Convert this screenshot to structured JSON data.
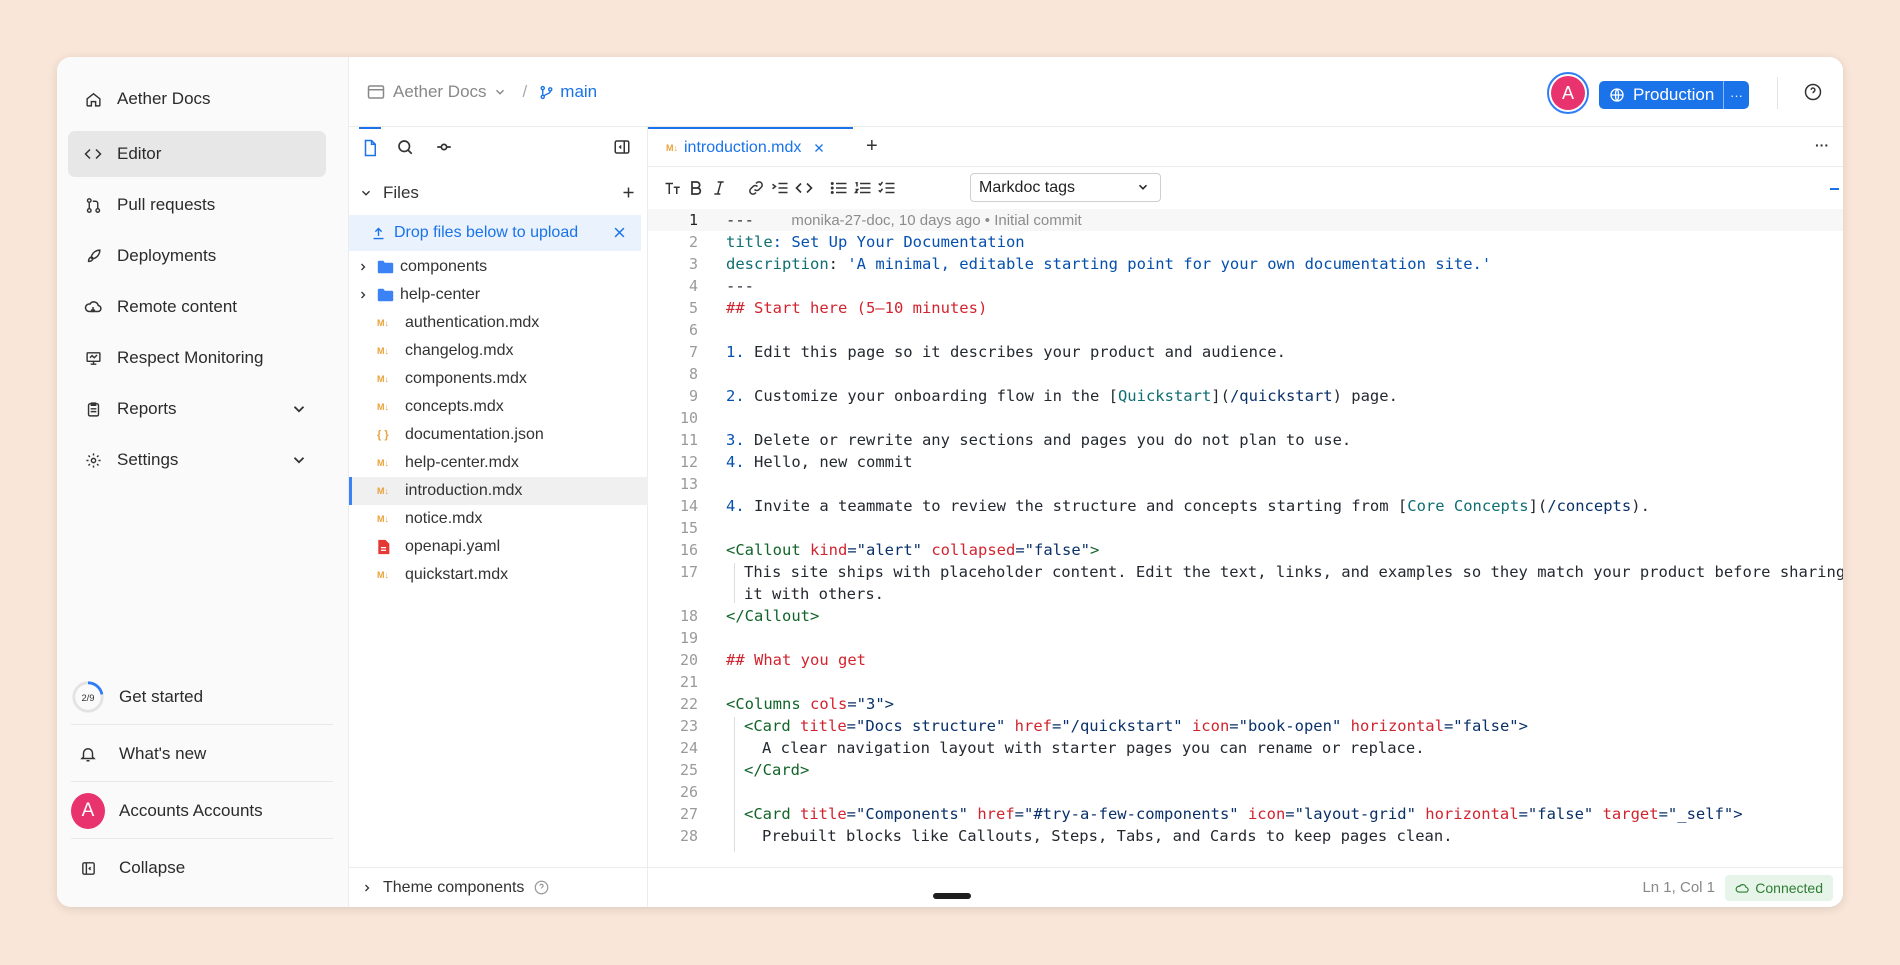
{
  "sidebar": {
    "items": [
      {
        "label": "Aether Docs",
        "icon": "home-icon"
      },
      {
        "label": "Editor",
        "icon": "code-icon"
      },
      {
        "label": "Pull requests",
        "icon": "pull-request-icon"
      },
      {
        "label": "Deployments",
        "icon": "rocket-icon"
      },
      {
        "label": "Remote content",
        "icon": "cloud-icon"
      },
      {
        "label": "Respect Monitoring",
        "icon": "monitor-icon"
      },
      {
        "label": "Reports",
        "icon": "clipboard-icon"
      },
      {
        "label": "Settings",
        "icon": "gear-icon"
      }
    ],
    "progress": {
      "text": "2/9",
      "label": "Get started",
      "fraction": 0.22
    },
    "whats_new": "What's new",
    "account": {
      "initial": "A",
      "name": "Accounts Accounts"
    },
    "collapse": "Collapse"
  },
  "topbar": {
    "project": "Aether Docs",
    "separator": "/",
    "branch": "main",
    "avatar_initial": "A",
    "env_button": "Production",
    "more": "···"
  },
  "files": {
    "header": "Files",
    "upload_hint": "Drop files below to upload",
    "folders": [
      "components",
      "help-center"
    ],
    "items": [
      {
        "name": "authentication.mdx",
        "type": "mdx"
      },
      {
        "name": "changelog.mdx",
        "type": "mdx"
      },
      {
        "name": "components.mdx",
        "type": "mdx"
      },
      {
        "name": "concepts.mdx",
        "type": "mdx"
      },
      {
        "name": "documentation.json",
        "type": "json"
      },
      {
        "name": "help-center.mdx",
        "type": "mdx"
      },
      {
        "name": "introduction.mdx",
        "type": "mdx"
      },
      {
        "name": "notice.mdx",
        "type": "mdx"
      },
      {
        "name": "openapi.yaml",
        "type": "yaml"
      },
      {
        "name": "quickstart.mdx",
        "type": "mdx"
      }
    ],
    "mdx_badge": "M↓",
    "json_badge": "{ }",
    "theme_components": "Theme components"
  },
  "editor": {
    "tab": "introduction.mdx",
    "add_tab": "+",
    "overflow": "···",
    "dropdown": "Markdoc tags",
    "blame": "monika-27-doc, 10 days ago • Initial commit",
    "line_numbers": [
      "1",
      "2",
      "3",
      "4",
      "5",
      "6",
      "7",
      "8",
      "9",
      "10",
      "11",
      "12",
      "13",
      "14",
      "15",
      "16",
      "17",
      "",
      "18",
      "19",
      "20",
      "21",
      "22",
      "23",
      "24",
      "25",
      "26",
      "27",
      "28"
    ],
    "code": {
      "l1": "---",
      "l2a": "title",
      "l2b": ": Set Up Your Documentation",
      "l3a": "description",
      "l3b": ": ",
      "l3c": "'A minimal, editable starting point for your own documentation site.'",
      "l4": "---",
      "l5": "## Start here (5–10 minutes)",
      "l7a": "1.",
      "l7b": " Edit this page so it describes your product and audience.",
      "l9a": "2.",
      "l9b": " Customize your onboarding flow in the [",
      "l9c": "Quickstart",
      "l9d": "](",
      "l9e": "/quickstart",
      "l9f": ") page.",
      "l11a": "3.",
      "l11b": " Delete or rewrite any sections and pages you do not plan to use.",
      "l12a": "4.",
      "l12b": " Hello, new commit",
      "l14a": "4.",
      "l14b": " Invite a teammate to review the structure and concepts starting from [",
      "l14c": "Core Concepts",
      "l14d": "](",
      "l14e": "/concepts",
      "l14f": ").",
      "l16a": "<Callout ",
      "l16b": "kind",
      "l16c": "=\"alert\" ",
      "l16d": "collapsed",
      "l16e": "=\"false\"",
      "l16f": ">",
      "l17a": "This site ships with placeholder content. Edit the text, links, and examples so they match your product before sharing",
      "l17b": "it with others.",
      "l18": "</Callout>",
      "l20": "## What you get",
      "l22a": "<Columns ",
      "l22b": "cols",
      "l22c": "=\"3\">",
      "l23a": "<Card ",
      "l23b": "title",
      "l23c": "=\"Docs structure\" ",
      "l23d": "href",
      "l23e": "=\"/quickstart\" ",
      "l23f": "icon",
      "l23g": "=\"book-open\" ",
      "l23h": "horizontal",
      "l23i": "=\"false\">",
      "l24": "A clear navigation layout with starter pages you can rename or replace.",
      "l25": "</Card>",
      "l27a": "<Card ",
      "l27b": "title",
      "l27c": "=\"Components\" ",
      "l27d": "href",
      "l27e": "=\"#try-a-few-components\" ",
      "l27f": "icon",
      "l27g": "=\"layout-grid\" ",
      "l27h": "horizontal",
      "l27i": "=\"false\" ",
      "l27j": "target",
      "l27k": "=\"_self\">",
      "l28": "Prebuilt blocks like Callouts, Steps, Tabs, and Cards to keep pages clean."
    },
    "status": {
      "position": "Ln 1, Col 1",
      "connection": "Connected"
    }
  },
  "colors": {
    "accent": "#1a73e8",
    "avatar": "#e8336f",
    "connected_bg": "#e6f4ea",
    "connected_fg": "#2e7d32"
  }
}
